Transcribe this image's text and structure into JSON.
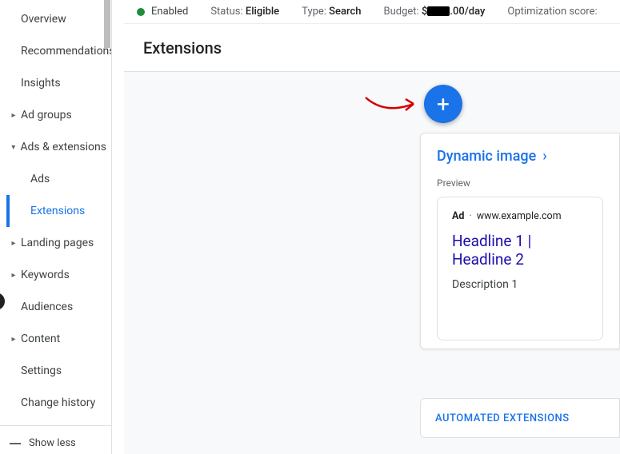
{
  "sidebar": {
    "items": [
      {
        "label": "Overview",
        "arrow": false
      },
      {
        "label": "Recommendations",
        "arrow": false
      },
      {
        "label": "Insights",
        "arrow": false
      },
      {
        "label": "Ad groups",
        "arrow": true,
        "expanded": false
      },
      {
        "label": "Ads & extensions",
        "arrow": true,
        "expanded": true
      },
      {
        "label": "Landing pages",
        "arrow": true,
        "expanded": false
      },
      {
        "label": "Keywords",
        "arrow": true,
        "expanded": false
      },
      {
        "label": "Audiences",
        "arrow": false
      },
      {
        "label": "Content",
        "arrow": true,
        "expanded": false
      },
      {
        "label": "Settings",
        "arrow": false
      },
      {
        "label": "Change history",
        "arrow": false
      }
    ],
    "sub_ads": "Ads",
    "sub_extensions": "Extensions",
    "show_less": "Show less"
  },
  "status": {
    "enabled": "Enabled",
    "status_label": "Status:",
    "status_value": "Eligible",
    "type_label": "Type:",
    "type_value": "Search",
    "budget_label": "Budget:",
    "budget_prefix": "$",
    "budget_suffix": ".00/day",
    "opt_label": "Optimization score:"
  },
  "page": {
    "title": "Extensions"
  },
  "fab": {
    "glyph": "+"
  },
  "card": {
    "title": "Dynamic image",
    "preview_label": "Preview",
    "ad_tag": "Ad",
    "ad_url": "www.example.com",
    "headline": "Headline 1 | Headline 2",
    "description": "Description 1"
  },
  "auto_ext": {
    "label": "AUTOMATED EXTENSIONS"
  }
}
